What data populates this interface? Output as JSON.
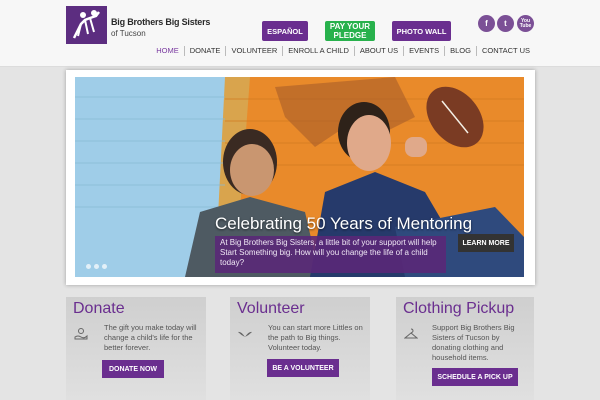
{
  "header": {
    "logo_line1": "Big Brothers Big Sisters",
    "logo_line2": "of Tucson",
    "espanol": "ESPAÑOL",
    "pledge_line1": "PAY YOUR",
    "pledge_line2": "PLEDGE",
    "photo_wall": "PHOTO WALL",
    "social": {
      "facebook": "f",
      "twitter": "t",
      "youtube": "You Tube"
    }
  },
  "nav": [
    "HOME",
    "DONATE",
    "VOLUNTEER",
    "ENROLL A CHILD",
    "ABOUT US",
    "EVENTS",
    "BLOG",
    "CONTACT US"
  ],
  "hero": {
    "title": "Celebrating 50 Years of Mentoring",
    "caption": "At Big Brothers Big Sisters, a little bit of your support will help Start Something big. How will you change the life of a child today?",
    "button": "LEARN MORE"
  },
  "panels": {
    "donate": {
      "title": "Donate",
      "text": "The gift you make today will change a child's life for the better forever.",
      "button": "DONATE NOW"
    },
    "volunteer": {
      "title": "Volunteer",
      "text": "You can start more Littles on the path to Big things. Volunteer today.",
      "button": "BE A VOLUNTEER"
    },
    "clothing": {
      "title": "Clothing Pickup",
      "text": "Support Big Brothers Big Sisters of Tucson by donating clothing and household items.",
      "button": "SCHEDULE A PICK UP"
    }
  },
  "colors": {
    "brand_purple": "#6a2e8f",
    "pledge_green": "#28b14c"
  }
}
